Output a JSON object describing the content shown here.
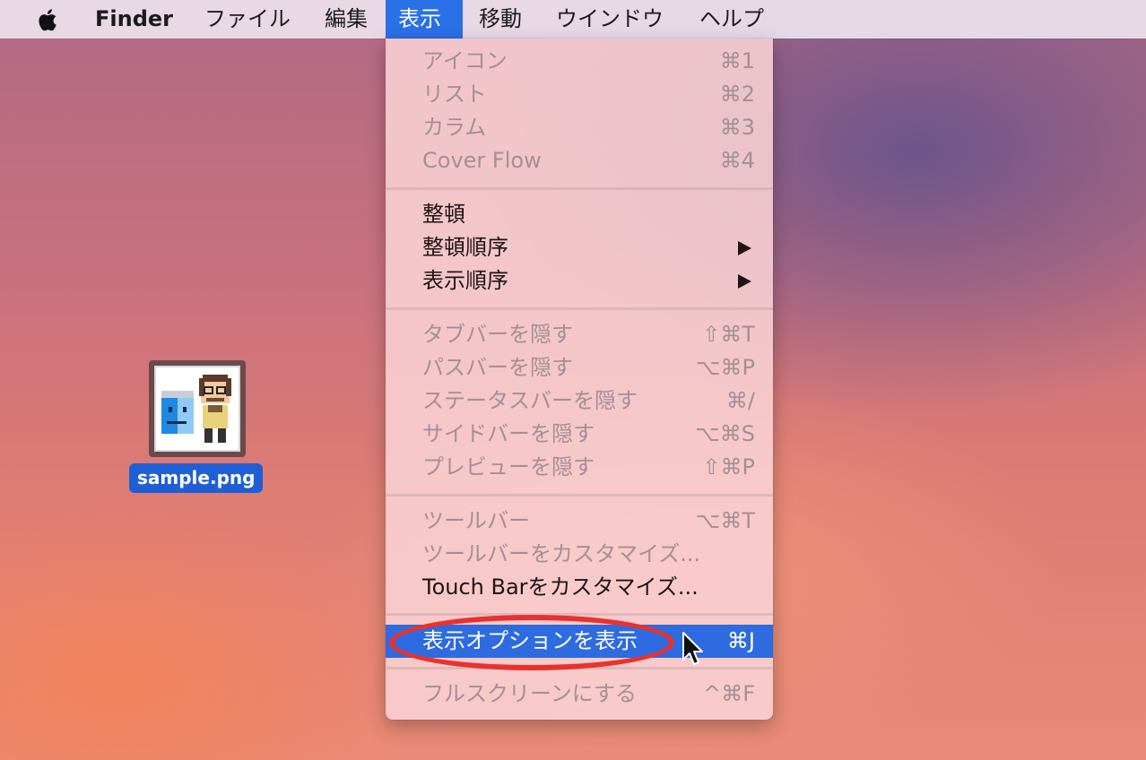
{
  "menubar": {
    "apple_icon": "apple-logo-icon",
    "items": [
      {
        "label": "Finder"
      },
      {
        "label": "ファイル"
      },
      {
        "label": "編集"
      },
      {
        "label": "表示"
      },
      {
        "label": "移動"
      },
      {
        "label": "ウインドウ"
      },
      {
        "label": "ヘルプ"
      }
    ],
    "active_item": "表示"
  },
  "view_menu": {
    "items": [
      {
        "label": "アイコン",
        "shortcut": "⌘1",
        "enabled": false
      },
      {
        "label": "リスト",
        "shortcut": "⌘2",
        "enabled": false
      },
      {
        "label": "カラム",
        "shortcut": "⌘3",
        "enabled": false
      },
      {
        "label": "Cover Flow",
        "shortcut": "⌘4",
        "enabled": false
      },
      {
        "label": "整頓",
        "shortcut": "",
        "enabled": true
      },
      {
        "label": "整頓順序",
        "shortcut": "",
        "enabled": true,
        "submenu": true
      },
      {
        "label": "表示順序",
        "shortcut": "",
        "enabled": true,
        "submenu": true
      },
      {
        "label": "タブバーを隠す",
        "shortcut": "⇧⌘T",
        "enabled": false
      },
      {
        "label": "パスバーを隠す",
        "shortcut": "⌥⌘P",
        "enabled": false
      },
      {
        "label": "ステータスバーを隠す",
        "shortcut": "⌘/",
        "enabled": false
      },
      {
        "label": "サイドバーを隠す",
        "shortcut": "⌥⌘S",
        "enabled": false
      },
      {
        "label": "プレビューを隠す",
        "shortcut": "⇧⌘P",
        "enabled": false
      },
      {
        "label": "ツールバー",
        "shortcut": "⌥⌘T",
        "enabled": false
      },
      {
        "label": "ツールバーをカスタマイズ...",
        "shortcut": "",
        "enabled": false
      },
      {
        "label": "Touch Barをカスタマイズ...",
        "shortcut": "",
        "enabled": true
      },
      {
        "label": "表示オプションを表示",
        "shortcut": "⌘J",
        "enabled": true,
        "highlighted": true
      },
      {
        "label": "フルスクリーンにする",
        "shortcut": "^⌘F",
        "enabled": false
      }
    ],
    "highlight_color": "#2e6be0",
    "callout_color": "#e8322e"
  },
  "desktop": {
    "file": {
      "name": "sample.png",
      "selected": true
    }
  }
}
